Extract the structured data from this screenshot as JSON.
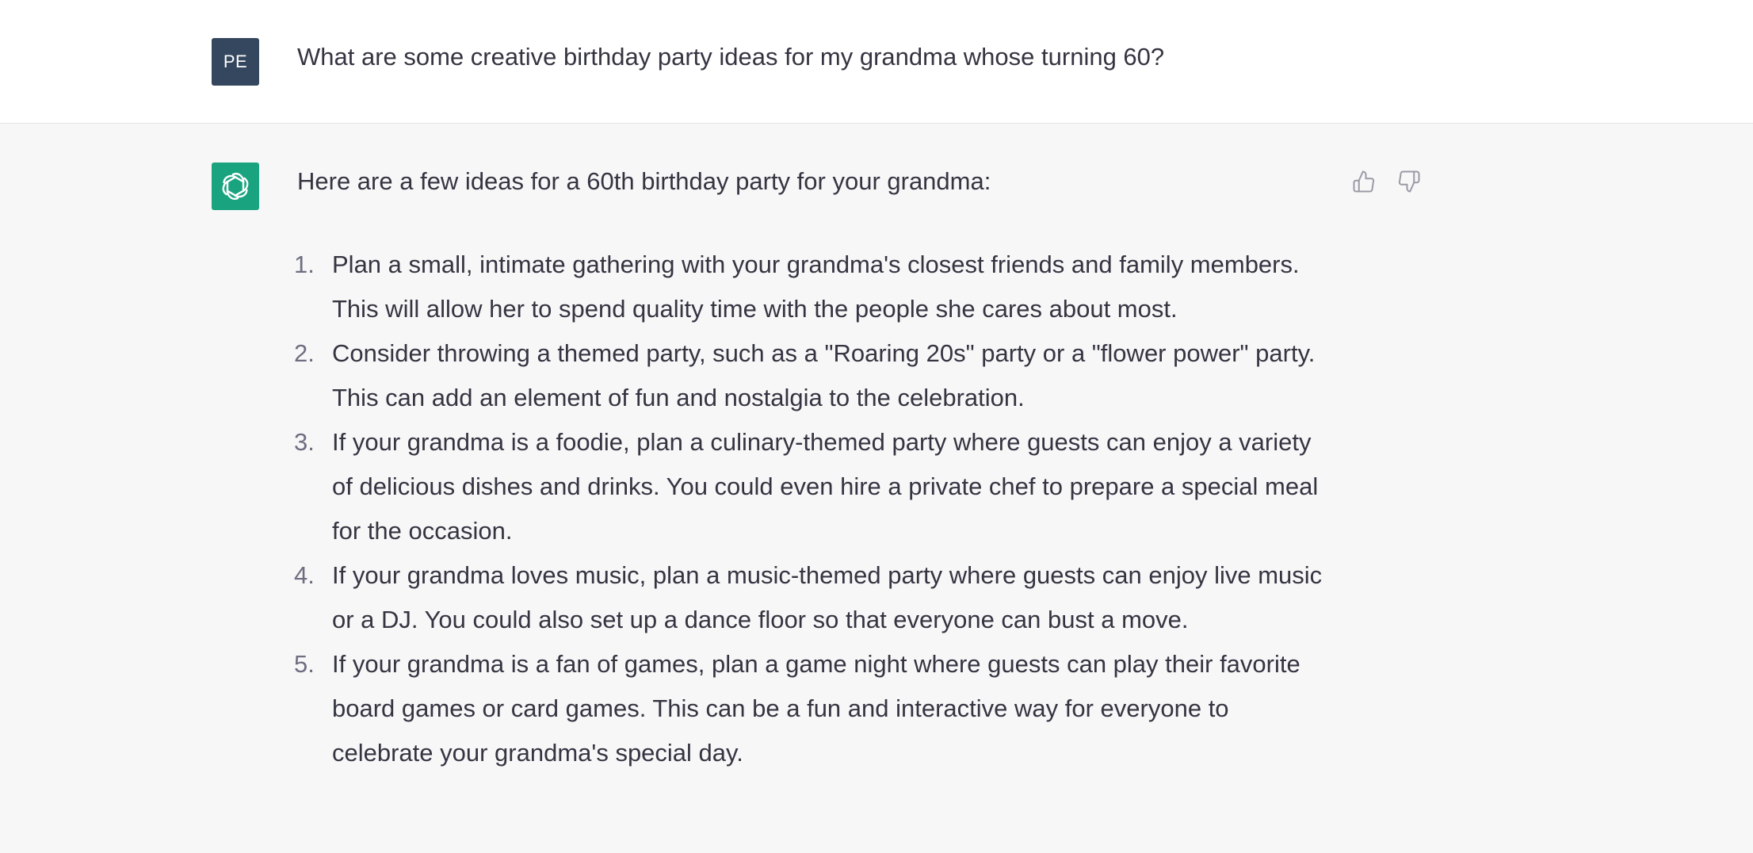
{
  "user": {
    "avatar_initials": "PE",
    "message": "What are some creative birthday party ideas for my grandma whose turning 60?"
  },
  "assistant": {
    "avatar_icon": "openai-logo-icon",
    "intro": "Here are a few ideas for a 60th birthday party for your grandma:",
    "ideas": [
      {
        "num": "1.",
        "text": "Plan a small, intimate gathering with your grandma's closest friends and family members. This will allow her to spend quality time with the people she cares about most."
      },
      {
        "num": "2.",
        "text": "Consider throwing a themed party, such as a \"Roaring 20s\" party or a \"flower power\" party. This can add an element of fun and nostalgia to the celebration."
      },
      {
        "num": "3.",
        "text": "If your grandma is a foodie, plan a culinary-themed party where guests can enjoy a variety of delicious dishes and drinks. You could even hire a private chef to prepare a special meal for the occasion."
      },
      {
        "num": "4.",
        "text": "If your grandma loves music, plan a music-themed party where guests can enjoy live music or a DJ. You could also set up a dance floor so that everyone can bust a move."
      },
      {
        "num": "5.",
        "text": "If your grandma is a fan of games, plan a game night where guests can play their favorite board games or card games. This can be a fun and interactive way for everyone to celebrate your grandma's special day."
      }
    ]
  },
  "feedback": {
    "up_icon": "thumbs-up-icon",
    "down_icon": "thumbs-down-icon"
  },
  "colors": {
    "user_avatar_bg": "#35475e",
    "bot_avatar_bg": "#19a37f",
    "text": "#343541",
    "assistant_bg": "#f7f7f8"
  }
}
